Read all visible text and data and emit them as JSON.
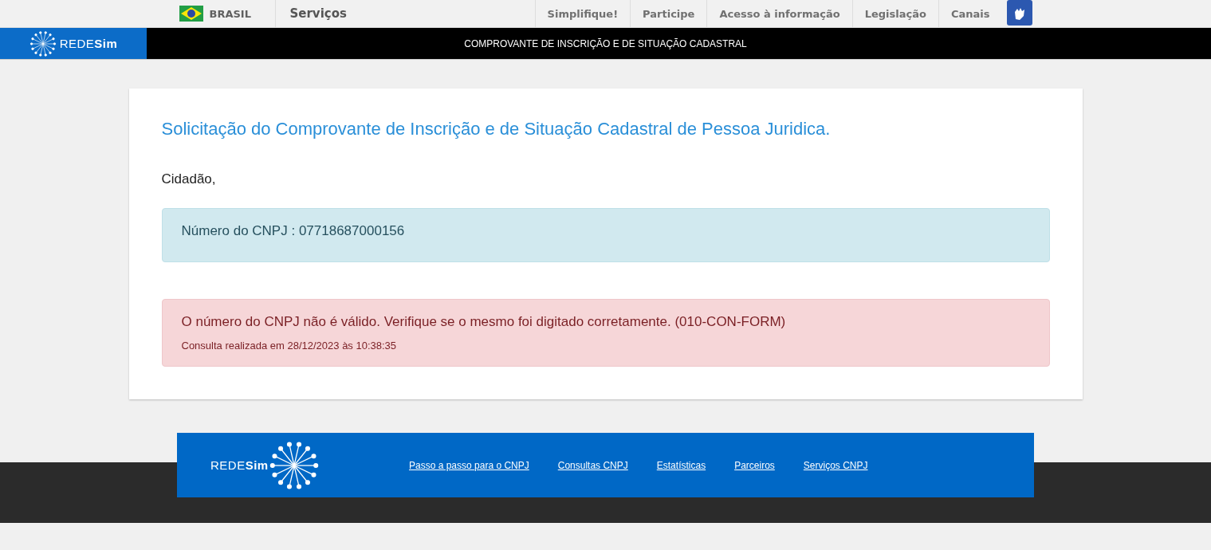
{
  "gov_bar": {
    "country": "BRASIL",
    "services": "Serviços",
    "links": [
      "Simplifique!",
      "Participe",
      "Acesso à informação",
      "Legislação",
      "Canais"
    ]
  },
  "header": {
    "logo": {
      "prefix": "REDE",
      "suffix": "Sim"
    },
    "title": "COMPROVANTE DE INSCRIÇÃO E DE SITUAÇÃO CADASTRAL"
  },
  "card": {
    "heading": "Solicitação do Comprovante de Inscrição e de Situação Cadastral de Pessoa Juridica.",
    "greeting": "Cidadão,",
    "alerts": [
      {
        "kind": "info",
        "message": "Número do CNPJ : 07718687000156"
      },
      {
        "kind": "error",
        "message": "O número do CNPJ não é válido. Verifique se o mesmo foi digitado corretamente. (010-CON-FORM)",
        "note": "Consulta realizada em 28/12/2023 às 10:38:35"
      }
    ]
  },
  "footer": {
    "logo": {
      "prefix": "REDE",
      "suffix": "Sim"
    },
    "links": [
      "Passo a passo para o CNPJ",
      "Consultas CNPJ",
      "Estatísticas",
      "Parceiros",
      "Serviços CNPJ"
    ]
  }
}
